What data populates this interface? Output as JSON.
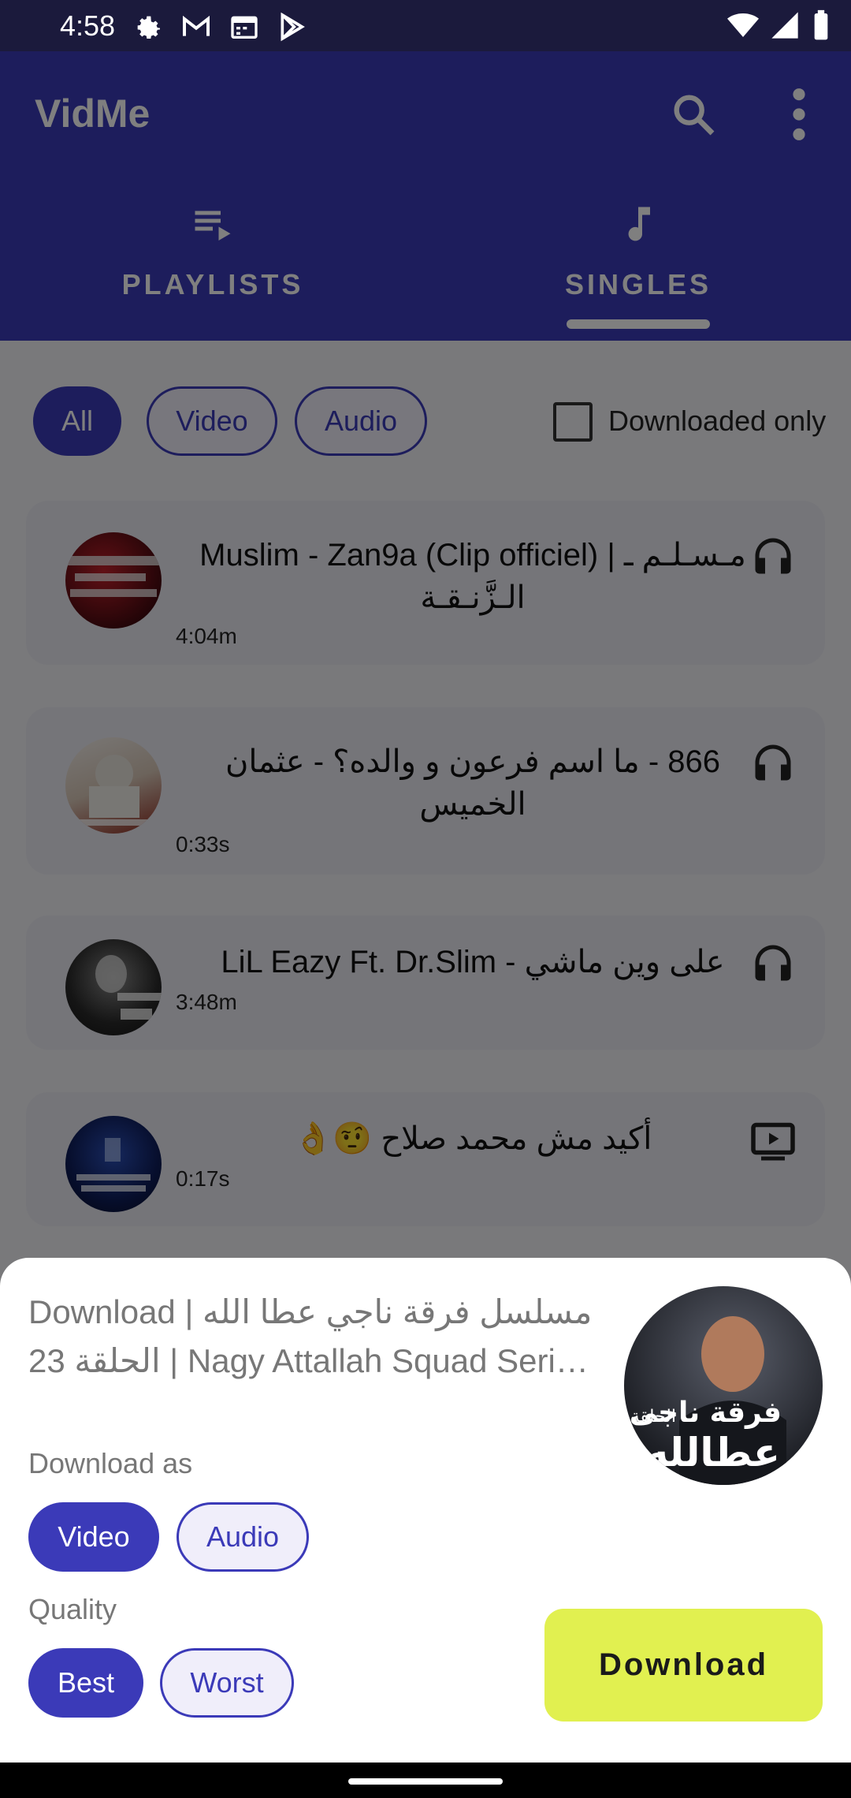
{
  "status_bar": {
    "time": "4:58",
    "left_icons": [
      "settings-icon",
      "gmail-icon",
      "calendar-icon",
      "play-store-icon"
    ],
    "right_icons": [
      "wifi-icon",
      "cell-signal-icon",
      "battery-icon"
    ]
  },
  "app_bar": {
    "title": "VidMe",
    "actions": [
      "search-icon",
      "more-vert-icon"
    ],
    "tabs": [
      {
        "label": "PLAYLISTS",
        "icon": "playlist-icon",
        "selected": false
      },
      {
        "label": "SINGLES",
        "icon": "music-note-icon",
        "selected": true
      }
    ]
  },
  "filters": {
    "chips": [
      {
        "label": "All",
        "selected": true
      },
      {
        "label": "Video",
        "selected": false
      },
      {
        "label": "Audio",
        "selected": false
      }
    ],
    "downloaded_only_label": "Downloaded only",
    "downloaded_only_checked": false
  },
  "list": [
    {
      "title": "Muslim - Zan9a (Clip officiel)  |  مـسـلـم ـ الـزَّنـقـة",
      "duration": "4:04m",
      "type_icon": "headphones-icon"
    },
    {
      "title": "866 - ما اسم فرعون و والده؟ - عثمان الخميس",
      "duration": "0:33s",
      "type_icon": "headphones-icon"
    },
    {
      "title": "LiL Eazy Ft. Dr.Slim - على وين ماشي",
      "duration": "3:48m",
      "type_icon": "headphones-icon"
    },
    {
      "title": "أكيد مش محمد صلاح 🤨👌",
      "duration": "0:17s",
      "type_icon": "video-icon"
    }
  ],
  "sheet": {
    "title_prefix": "Download ",
    "title": "مسلسل فرقة ناجي عطا الله | الحلقة 23 | Nagy Attallah Squad Seri…",
    "thumb_text_1": "فرقة ناجى",
    "thumb_text_2": "الحلقة",
    "thumb_text_3": "عطالله",
    "download_as_label": "Download as",
    "download_as_options": [
      {
        "label": "Video",
        "selected": true
      },
      {
        "label": "Audio",
        "selected": false
      }
    ],
    "quality_label": "Quality",
    "quality_options": [
      {
        "label": "Best",
        "selected": true
      },
      {
        "label": "Worst",
        "selected": false
      }
    ],
    "download_button": "Download"
  },
  "colors": {
    "primary": "#3b3ab8",
    "accent_button": "#e1f050",
    "status_bar": "#1b1a3c"
  }
}
